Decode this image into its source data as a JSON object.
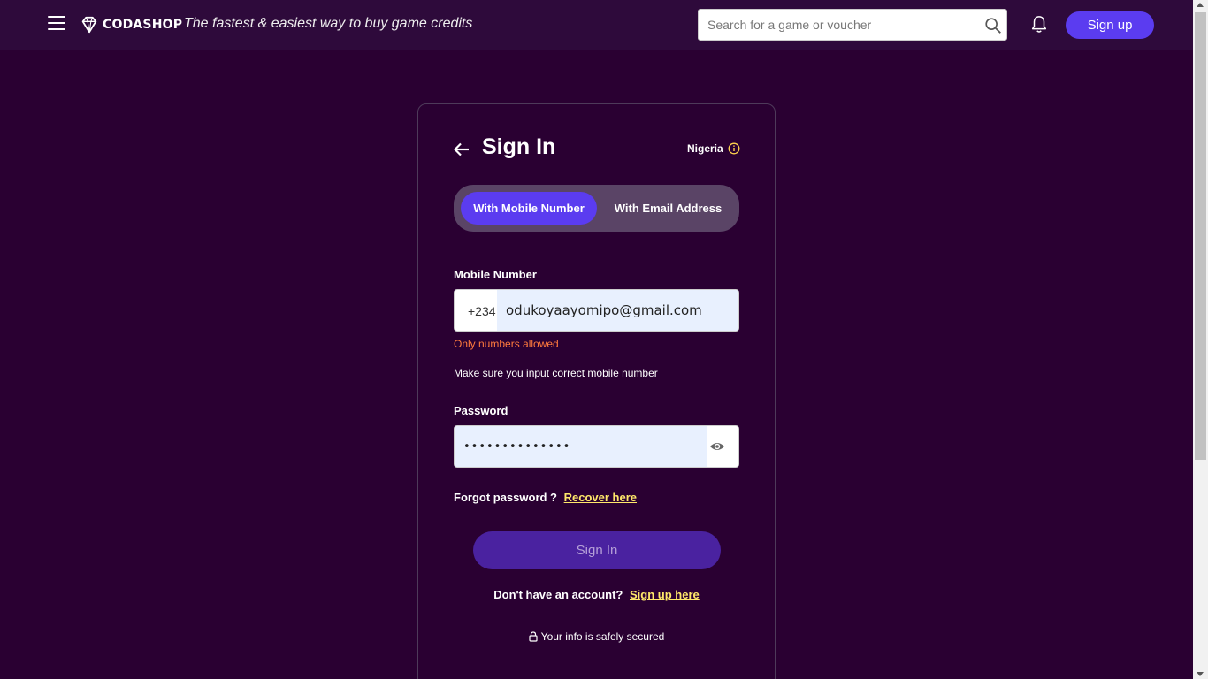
{
  "header": {
    "brand": "CODASHOP",
    "tagline": "The fastest & easiest way to buy game credits",
    "search_placeholder": "Search for a game or voucher",
    "signup_label": "Sign up"
  },
  "signin": {
    "title": "Sign In",
    "country": "Nigeria",
    "tabs": [
      {
        "label": "With Mobile Number",
        "active": true
      },
      {
        "label": "With Email Address",
        "active": false
      }
    ],
    "mobile_label": "Mobile Number",
    "country_code": "+234",
    "mobile_value": "odukoyaayomipo@gmail.com",
    "mobile_error": "Only numbers allowed",
    "mobile_hint": "Make sure you input correct mobile number",
    "password_label": "Password",
    "password_value": "••••••••••••••",
    "forgot_text": "Forgot password ?",
    "recover_link": "Recover here",
    "submit_label": "Sign In",
    "no_account_text": "Don't have an account?",
    "signup_link": "Sign up here",
    "secure_text": "Your info is safely secured"
  },
  "colors": {
    "background": "#2a0032",
    "accent": "#5b3cf0",
    "link": "#ffe86a",
    "error": "#ff7a3d"
  }
}
